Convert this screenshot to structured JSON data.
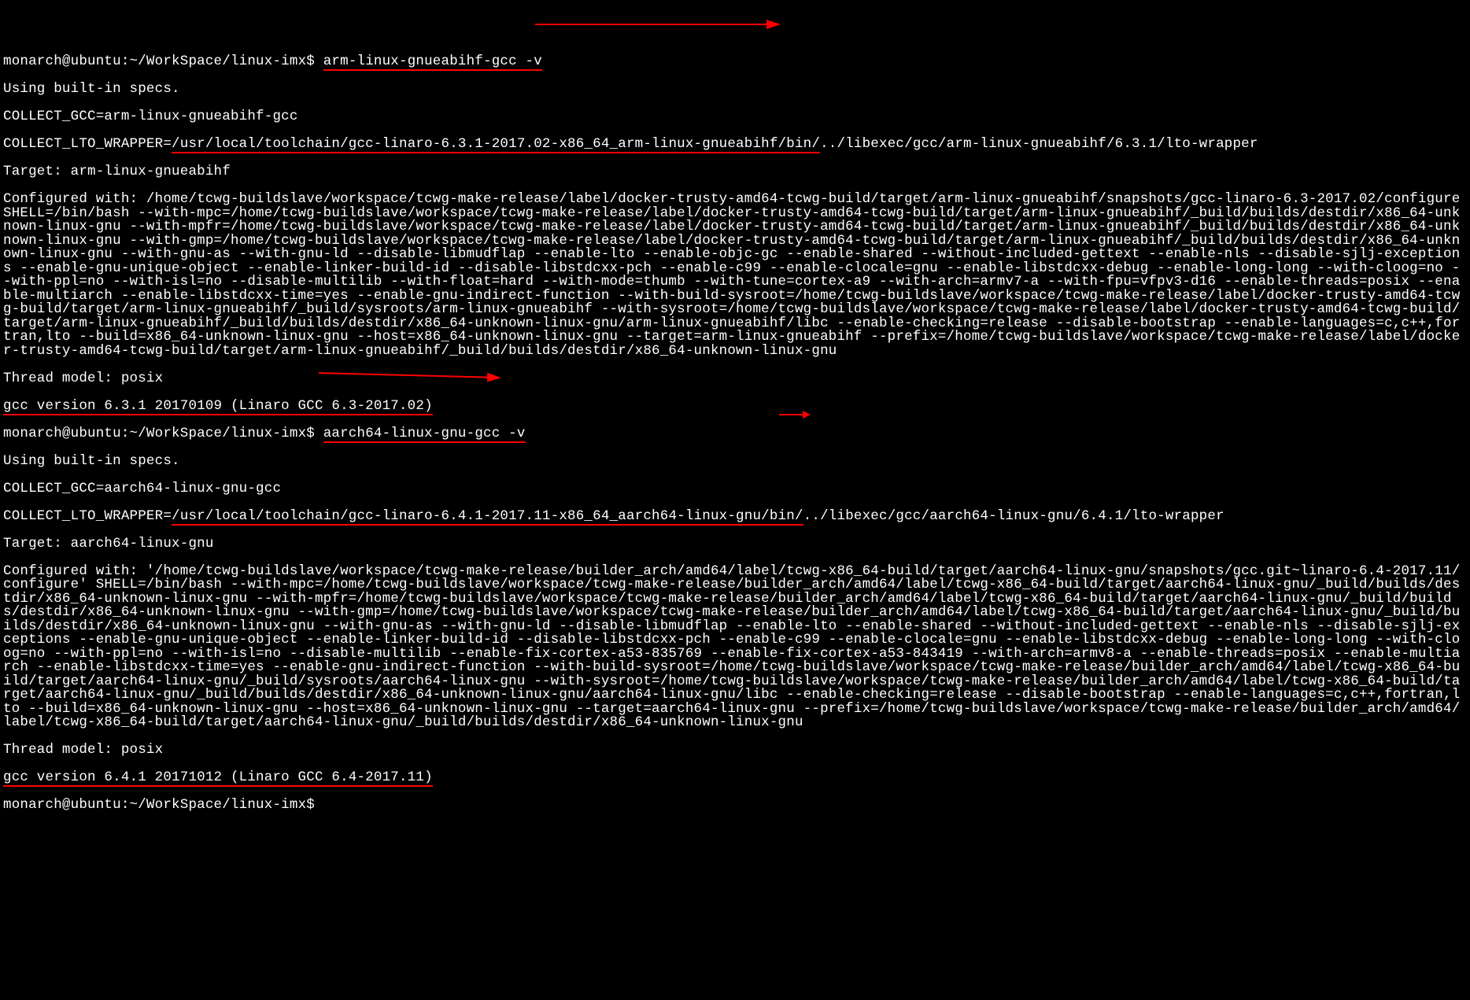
{
  "prompt1": {
    "user_host": "monarch@ubuntu",
    "sep": ":",
    "cwd": "~/WorkSpace/linux-imx",
    "dollar": "$ ",
    "cmd": "arm-linux-gnueabihf-gcc -v"
  },
  "out1": {
    "line1": "Using built-in specs.",
    "line2": "COLLECT_GCC=arm-linux-gnueabihf-gcc",
    "line3a": "COLLECT_LTO_WRAPPER=",
    "line3b": "/usr/local/toolchain/gcc-linaro-6.3.1-2017.02-x86_64_arm-linux-gnueabihf/bin/",
    "line3c": "../libexec/gcc/arm-linux-gnueabihf/6.3.1/lto-wrapper",
    "target": "Target: arm-linux-gnueabihf",
    "conf": "Configured with: /home/tcwg-buildslave/workspace/tcwg-make-release/label/docker-trusty-amd64-tcwg-build/target/arm-linux-gnueabihf/snapshots/gcc-linaro-6.3-2017.02/configure SHELL=/bin/bash --with-mpc=/home/tcwg-buildslave/workspace/tcwg-make-release/label/docker-trusty-amd64-tcwg-build/target/arm-linux-gnueabihf/_build/builds/destdir/x86_64-unknown-linux-gnu --with-mpfr=/home/tcwg-buildslave/workspace/tcwg-make-release/label/docker-trusty-amd64-tcwg-build/target/arm-linux-gnueabihf/_build/builds/destdir/x86_64-unknown-linux-gnu --with-gmp=/home/tcwg-buildslave/workspace/tcwg-make-release/label/docker-trusty-amd64-tcwg-build/target/arm-linux-gnueabihf/_build/builds/destdir/x86_64-unknown-linux-gnu --with-gnu-as --with-gnu-ld --disable-libmudflap --enable-lto --enable-objc-gc --enable-shared --without-included-gettext --enable-nls --disable-sjlj-exceptions --enable-gnu-unique-object --enable-linker-build-id --disable-libstdcxx-pch --enable-c99 --enable-clocale=gnu --enable-libstdcxx-debug --enable-long-long --with-cloog=no --with-ppl=no --with-isl=no --disable-multilib --with-float=hard --with-mode=thumb --with-tune=cortex-a9 --with-arch=armv7-a --with-fpu=vfpv3-d16 --enable-threads=posix --enable-multiarch --enable-libstdcxx-time=yes --enable-gnu-indirect-function --with-build-sysroot=/home/tcwg-buildslave/workspace/tcwg-make-release/label/docker-trusty-amd64-tcwg-build/target/arm-linux-gnueabihf/_build/sysroots/arm-linux-gnueabihf --with-sysroot=/home/tcwg-buildslave/workspace/tcwg-make-release/label/docker-trusty-amd64-tcwg-build/target/arm-linux-gnueabihf/_build/builds/destdir/x86_64-unknown-linux-gnu/arm-linux-gnueabihf/libc --enable-checking=release --disable-bootstrap --enable-languages=c,c++,fortran,lto --build=x86_64-unknown-linux-gnu --host=x86_64-unknown-linux-gnu --target=arm-linux-gnueabihf --prefix=/home/tcwg-buildslave/workspace/tcwg-make-release/label/docker-trusty-amd64-tcwg-build/target/arm-linux-gnueabihf/_build/builds/destdir/x86_64-unknown-linux-gnu",
    "thread": "Thread model: posix",
    "version": "gcc version 6.3.1 20170109 (Linaro GCC 6.3-2017.02)",
    "version_tail": " "
  },
  "prompt2": {
    "user_host": "monarch@ubuntu",
    "sep": ":",
    "cwd": "~/WorkSpace/linux-imx",
    "dollar": "$ ",
    "cmd": "aarch64-linux-gnu-gcc -v"
  },
  "out2": {
    "line1": "Using built-in specs.",
    "line2": "COLLECT_GCC=aarch64-linux-gnu-gcc",
    "line3a": "COLLECT_LTO_WRAPPER=",
    "line3b": "/usr/local/toolchain/gcc-linaro-6.4.1-2017.11-x86_64_aarch64-linux-gnu/bin/",
    "line3c": "../libexec/gcc/aarch64-linux-gnu/6.4.1/lto-wrapper",
    "target": "Target: aarch64-linux-gnu",
    "conf": "Configured with: '/home/tcwg-buildslave/workspace/tcwg-make-release/builder_arch/amd64/label/tcwg-x86_64-build/target/aarch64-linux-gnu/snapshots/gcc.git~linaro-6.4-2017.11/configure' SHELL=/bin/bash --with-mpc=/home/tcwg-buildslave/workspace/tcwg-make-release/builder_arch/amd64/label/tcwg-x86_64-build/target/aarch64-linux-gnu/_build/builds/destdir/x86_64-unknown-linux-gnu --with-mpfr=/home/tcwg-buildslave/workspace/tcwg-make-release/builder_arch/amd64/label/tcwg-x86_64-build/target/aarch64-linux-gnu/_build/builds/destdir/x86_64-unknown-linux-gnu --with-gmp=/home/tcwg-buildslave/workspace/tcwg-make-release/builder_arch/amd64/label/tcwg-x86_64-build/target/aarch64-linux-gnu/_build/builds/destdir/x86_64-unknown-linux-gnu --with-gnu-as --with-gnu-ld --disable-libmudflap --enable-lto --enable-shared --without-included-gettext --enable-nls --disable-sjlj-exceptions --enable-gnu-unique-object --enable-linker-build-id --disable-libstdcxx-pch --enable-c99 --enable-clocale=gnu --enable-libstdcxx-debug --enable-long-long --with-cloog=no --with-ppl=no --with-isl=no --disable-multilib --enable-fix-cortex-a53-835769 --enable-fix-cortex-a53-843419 --with-arch=armv8-a --enable-threads=posix --enable-multiarch --enable-libstdcxx-time=yes --enable-gnu-indirect-function --with-build-sysroot=/home/tcwg-buildslave/workspace/tcwg-make-release/builder_arch/amd64/label/tcwg-x86_64-build/target/aarch64-linux-gnu/_build/sysroots/aarch64-linux-gnu --with-sysroot=/home/tcwg-buildslave/workspace/tcwg-make-release/builder_arch/amd64/label/tcwg-x86_64-build/target/aarch64-linux-gnu/_build/builds/destdir/x86_64-unknown-linux-gnu/aarch64-linux-gnu/libc --enable-checking=release --disable-bootstrap --enable-languages=c,c++,fortran,lto --build=x86_64-unknown-linux-gnu --host=x86_64-unknown-linux-gnu --target=aarch64-linux-gnu --prefix=/home/tcwg-buildslave/workspace/tcwg-make-release/builder_arch/amd64/label/tcwg-x86_64-build/target/aarch64-linux-gnu/_build/builds/destdir/x86_64-unknown-linux-gnu",
    "thread": "Thread model: posix",
    "version": "gcc version 6.4.1 20171012 (Linaro GCC 6.4-2017.11)",
    "version_tail": " "
  },
  "prompt3": {
    "user_host": "monarch@ubuntu",
    "sep": ":",
    "cwd": "~/WorkSpace/linux-imx",
    "dollar": "$"
  }
}
